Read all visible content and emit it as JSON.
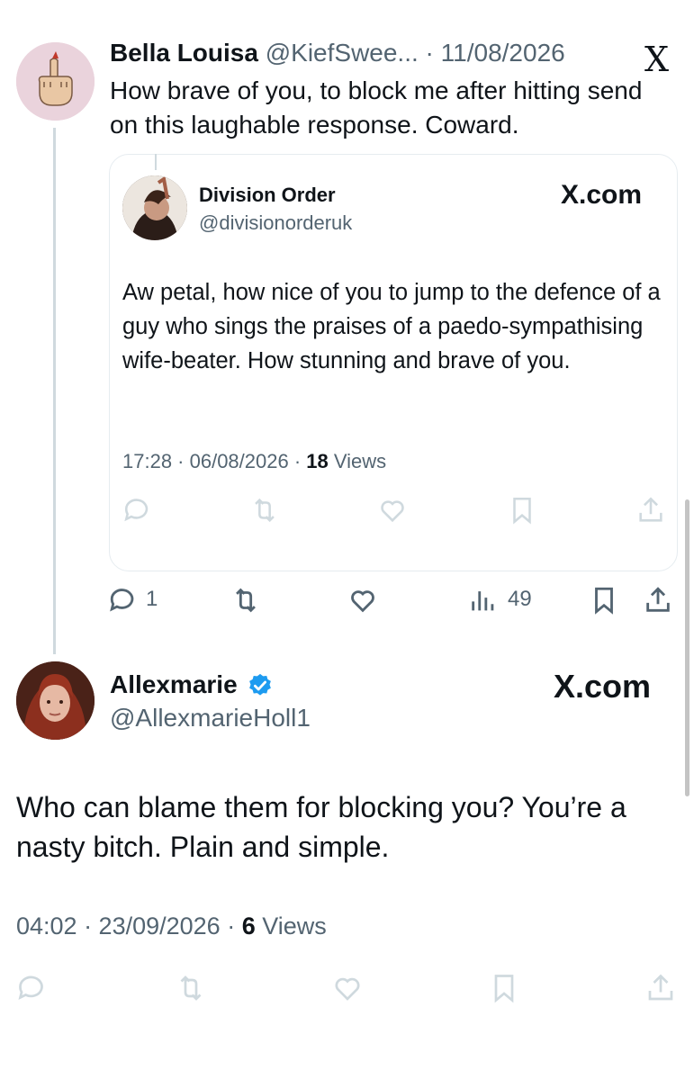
{
  "reply": {
    "name": "Bella Louisa",
    "handle_date": "@KiefSwee... · 11/08/2026",
    "text": "How brave of you, to block me after hitting send on this laughable response. Coward.",
    "x_logo": "X",
    "reply_count": "1",
    "views_count": "49",
    "icons": [
      "reply-icon",
      "retweet-icon",
      "like-icon",
      "views-icon",
      "bookmark-icon",
      "share-icon"
    ]
  },
  "quote": {
    "name": "Division Order",
    "handle": "@divisionorderuk",
    "site": "X.com",
    "text": "Aw petal, how nice of you to jump to the defence of a guy who sings the praises of a paedo-sympathising wife-beater. How stunning and brave of you.",
    "time_date": "17:28 · 06/08/2026 · ",
    "views_count": "18",
    "views_label": " Views"
  },
  "main": {
    "name": "Allexmarie",
    "handle": "@AllexmarieHoll1",
    "site": "X.com",
    "text": "Who can blame them for blocking you?  You’re a nasty bitch. Plain and simple.",
    "time_date": "04:02 · 23/09/2026 · ",
    "views_count": "6",
    "views_label": " Views"
  },
  "colors": {
    "text": "#0f1419",
    "secondary": "#536471",
    "verified": "#1d9bf0",
    "border": "#e6ecf0",
    "faded_icon": "#cfd9de"
  }
}
